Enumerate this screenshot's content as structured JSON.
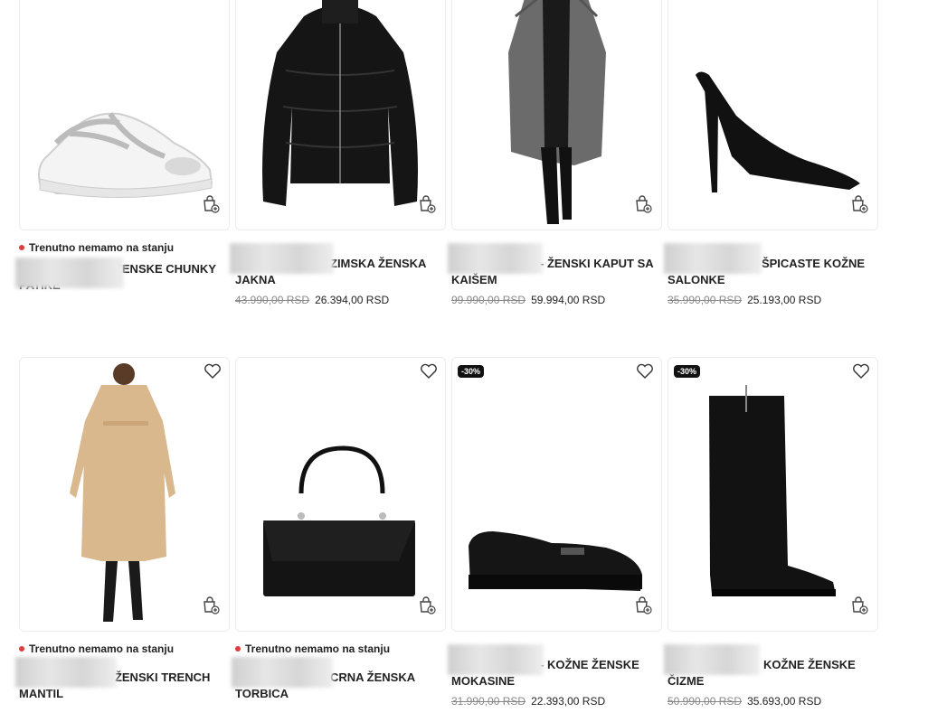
{
  "products": [
    {
      "stock": "Trenutno nemamo na stanju",
      "name_a": "- ŽENSKE CHUNKY",
      "name_b": "PATIKE",
      "old_price": "",
      "price": "",
      "badge": ""
    },
    {
      "stock": "",
      "name_a": "ZIMSKA ŽENSKA",
      "name_b": "JAKNA",
      "old_price": "43.990,00 RSD",
      "price": "26.394,00 RSD",
      "badge": ""
    },
    {
      "stock": "",
      "name_a": "- ŽENSKI KAPUT SA",
      "name_b": "KAIŠEM",
      "old_price": "99.990,00 RSD",
      "price": "59.994,00 RSD",
      "badge": ""
    },
    {
      "stock": "",
      "name_a": "- ŠPICASTE KOŽNE",
      "name_b": "SALONKE",
      "old_price": "35.990,00 RSD",
      "price": "25.193,00 RSD",
      "badge": ""
    },
    {
      "stock": "Trenutno nemamo na stanju",
      "name_a": "- ŽENSKI TRENCH",
      "name_b": "MANTIL",
      "old_price": "",
      "price": "",
      "badge": ""
    },
    {
      "stock": "Trenutno nemamo na stanju",
      "name_a": "CRNA ŽENSKA",
      "name_b": "TORBICA",
      "old_price": "",
      "price": "",
      "badge": ""
    },
    {
      "stock": "",
      "name_a": "- KOŽNE ŽENSKE",
      "name_b": "MOKASINE",
      "old_price": "31.990,00 RSD",
      "price": "22.393,00 RSD",
      "badge": "-30%"
    },
    {
      "stock": "",
      "name_a": "KOŽNE ŽENSKE",
      "name_b": "ČIZME",
      "old_price": "50.990,00 RSD",
      "price": "35.693,00 RSD",
      "badge": "-30%"
    }
  ],
  "colors": {
    "stock_dot": "#e23b3b",
    "badge_bg": "#111111"
  }
}
